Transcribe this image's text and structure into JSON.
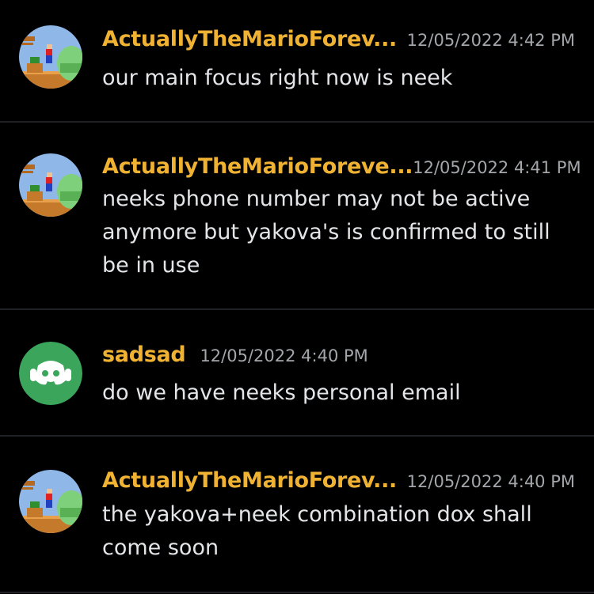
{
  "messages": [
    {
      "username": "ActuallyTheMarioForev...",
      "timestamp": "12/05/2022 4:42 PM",
      "text": "our main focus right now is neek",
      "avatar": "mario-forever-avatar"
    },
    {
      "username": "ActuallyTheMarioForeve...",
      "timestamp": "12/05/2022 4:41 PM",
      "text": "neeks phone number may not be active anymore but yakova's is confirmed to still be in use",
      "avatar": "mario-forever-avatar"
    },
    {
      "username": "sadsad",
      "timestamp": "12/05/2022 4:40 PM",
      "text": "do we have neeks personal email",
      "avatar": "default-discord-avatar"
    },
    {
      "username": "ActuallyTheMarioForev...",
      "timestamp": "12/05/2022 4:40 PM",
      "text": "the yakova+neek combination dox shall come soon",
      "avatar": "mario-forever-avatar"
    }
  ],
  "colors": {
    "background": "#000000",
    "username": "#f0b232",
    "timestamp": "#a3a6aa",
    "text": "#e3e5e8",
    "divider": "#1f2023",
    "default_avatar": "#3ba55c"
  }
}
